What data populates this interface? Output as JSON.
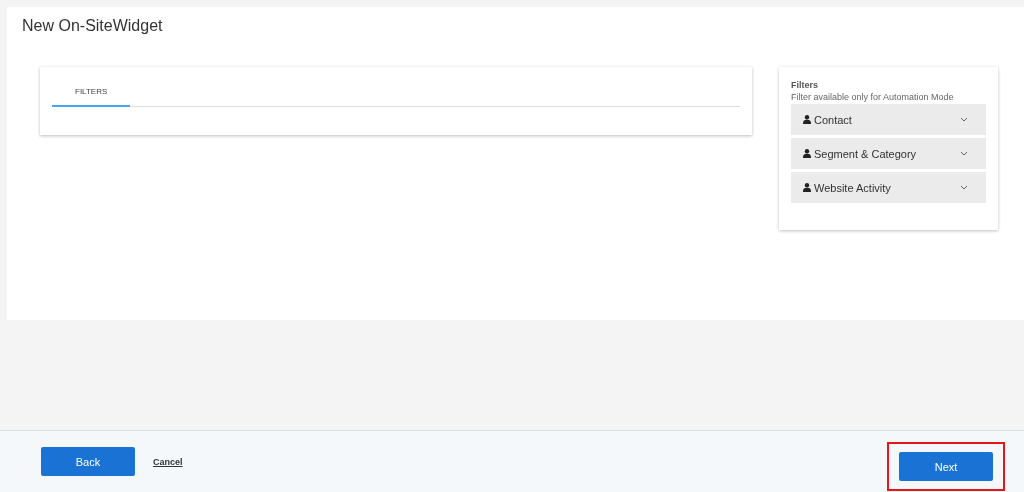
{
  "page": {
    "title": "New On-SiteWidget"
  },
  "tabs": [
    {
      "label": "FILTERS",
      "selected": true
    }
  ],
  "filters_panel": {
    "title": "Filters",
    "note": "Filter available only for Automation Mode",
    "groups": [
      {
        "label": "Contact",
        "expanded": false
      },
      {
        "label": "Segment & Category",
        "expanded": false
      },
      {
        "label": "Website Activity",
        "expanded": false
      }
    ]
  },
  "footer": {
    "back": "Back",
    "cancel": "Cancel",
    "next": {
      "label": "Next",
      "highlighted": true
    }
  }
}
